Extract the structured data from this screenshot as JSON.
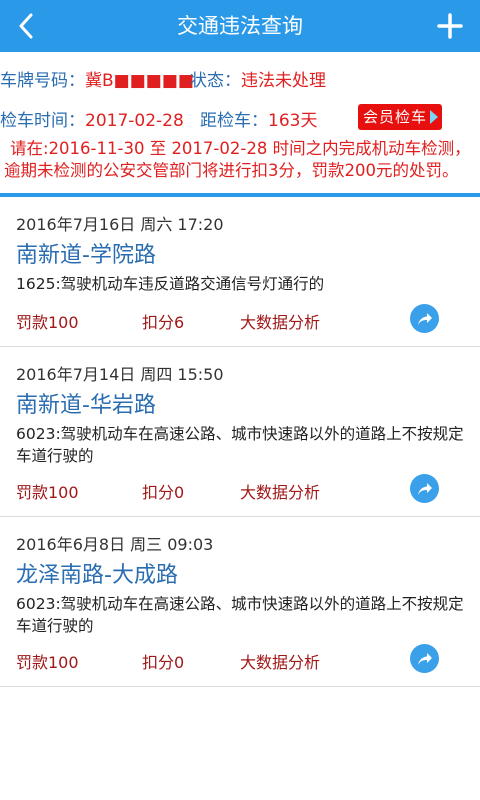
{
  "header": {
    "title": "交通违法查询",
    "back_icon": "back-arrow-icon",
    "add_icon": "plus-icon",
    "bg_color": "#2a9ae8"
  },
  "vehicle": {
    "plate_label": "车牌号码：",
    "plate_value": "冀B■■■■■",
    "status_label": "状态：",
    "status_value": "违法未处理",
    "inspect_label": "检车时间：",
    "inspect_value": "2017-02-28",
    "countdown_label": "距检车：",
    "countdown_value": "163天",
    "vip_button": "会员检车",
    "notice": "请在:2016-11-30 至 2017-02-28 时间之内完成机动车检测，逾期未检测的公安交管部门将进行扣3分，罚款200元的处罚。"
  },
  "violations": [
    {
      "datetime": "2016年7月16日  周六  17:20",
      "location": "南新道-学院路",
      "description": "1625:驾驶机动车违反道路交通信号灯通行的",
      "fine": "罚款100",
      "points": "扣分6",
      "analysis": "大数据分析"
    },
    {
      "datetime": "2016年7月14日  周四  15:50",
      "location": "南新道-华岩路",
      "description": "6023:驾驶机动车在高速公路、城市快速路以外的道路上不按规定车道行驶的",
      "fine": "罚款100",
      "points": "扣分0",
      "analysis": "大数据分析"
    },
    {
      "datetime": "2016年6月8日  周三  09:03",
      "location": "龙泽南路-大成路",
      "description": "6023:驾驶机动车在高速公路、城市快速路以外的道路上不按规定车道行驶的",
      "fine": "罚款100",
      "points": "扣分0",
      "analysis": "大数据分析"
    }
  ]
}
